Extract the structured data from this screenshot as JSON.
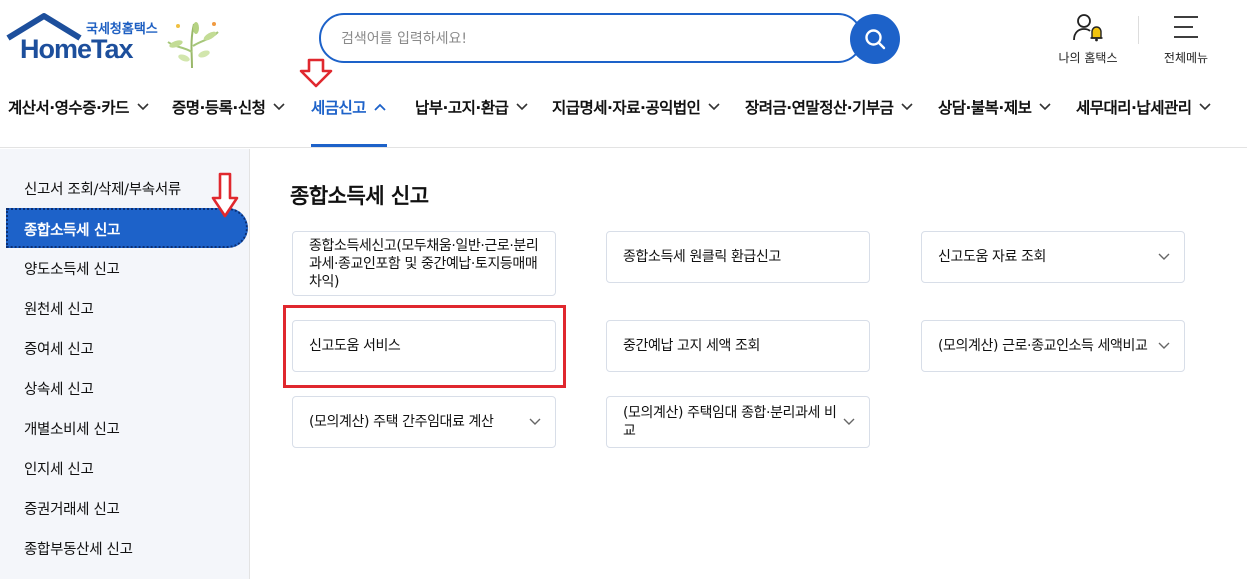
{
  "header": {
    "logo_top": "국세청홈택스",
    "logo_main": "HomeTax",
    "search_placeholder": "검색어를 입력하세요!",
    "my_hometax": "나의 홈택스",
    "all_menu": "전체메뉴"
  },
  "gnb": {
    "items": [
      {
        "label": "계산서·영수증·카드"
      },
      {
        "label": "증명·등록·신청"
      },
      {
        "label": "세금신고"
      },
      {
        "label": "납부·고지·환급"
      },
      {
        "label": "지급명세·자료·공익법인"
      },
      {
        "label": "장려금·연말정산·기부금"
      },
      {
        "label": "상담·불복·제보"
      },
      {
        "label": "세무대리·납세관리"
      }
    ],
    "active_index": 2
  },
  "sidebar": {
    "items": [
      {
        "label": "신고서 조회/삭제/부속서류"
      },
      {
        "label": "종합소득세 신고"
      },
      {
        "label": "양도소득세 신고"
      },
      {
        "label": "원천세 신고"
      },
      {
        "label": "증여세 신고"
      },
      {
        "label": "상속세 신고"
      },
      {
        "label": "개별소비세 신고"
      },
      {
        "label": "인지세 신고"
      },
      {
        "label": "증권거래세 신고"
      },
      {
        "label": "종합부동산세 신고"
      }
    ],
    "active_index": 1
  },
  "main": {
    "title": "종합소득세 신고",
    "cards": [
      {
        "label": "종합소득세신고(모두채움·일반·근로·분리과세·종교인포함 및 중간예납·토지등매매차익)",
        "has_dropdown": false
      },
      {
        "label": "종합소득세 원클릭 환급신고",
        "has_dropdown": false
      },
      {
        "label": "신고도움 자료 조회",
        "has_dropdown": true
      },
      {
        "label": "신고도움 서비스",
        "has_dropdown": false
      },
      {
        "label": "중간예납 고지 세액 조회",
        "has_dropdown": false
      },
      {
        "label": "(모의계산) 근로·종교인소득 세액비교",
        "has_dropdown": true
      },
      {
        "label": "(모의계산) 주택 간주임대료 계산",
        "has_dropdown": true
      },
      {
        "label": "(모의계산) 주택임대 종합·분리과세 비교",
        "has_dropdown": true
      }
    ]
  },
  "colors": {
    "brand": "#1d62c9",
    "highlight": "#e0282e",
    "annotation_arrow": "#e0282e"
  }
}
